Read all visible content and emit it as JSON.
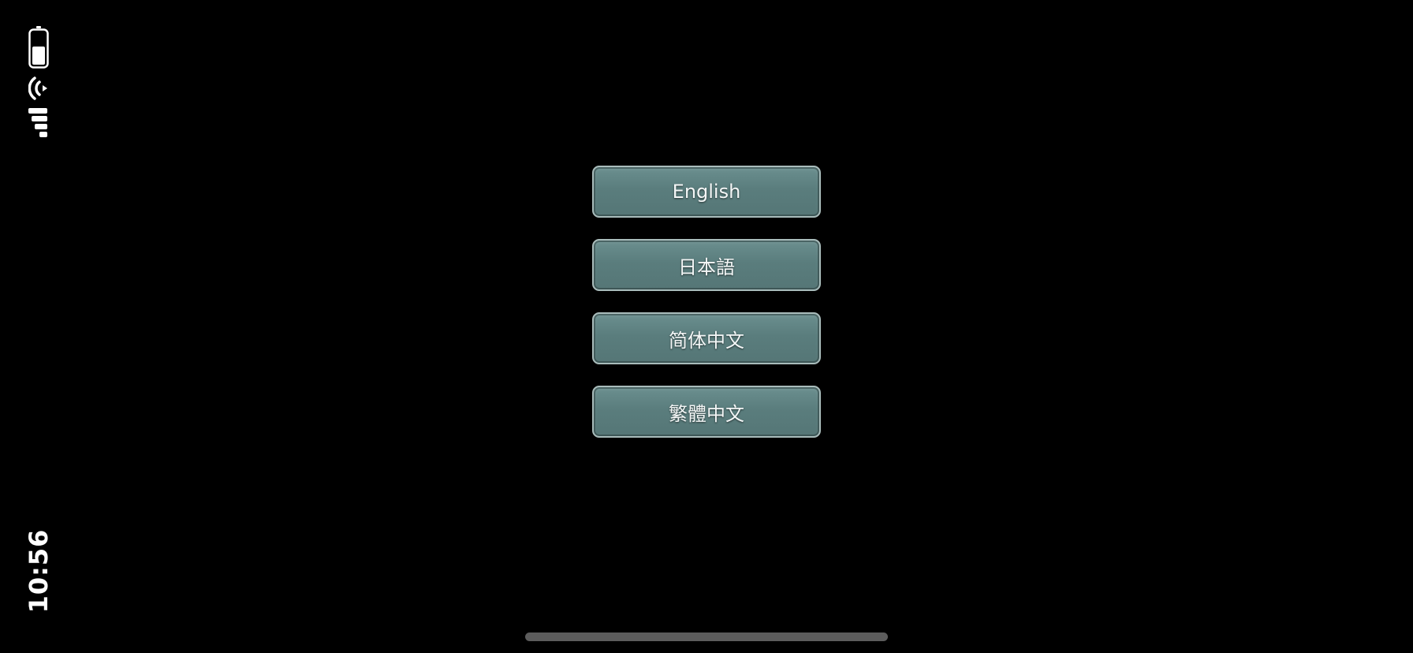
{
  "status_bar": {
    "time": "10:56",
    "battery_icon": "battery-icon",
    "wifi_icon": "wifi-icon",
    "signal_icon": "cellular-signal-icon"
  },
  "language_menu": {
    "options": [
      {
        "label": "English"
      },
      {
        "label": "日本語"
      },
      {
        "label": "简体中文"
      },
      {
        "label": "繁體中文"
      }
    ]
  },
  "colors": {
    "background": "#000000",
    "button_fill": "#5f8383",
    "button_border": "#a9bcbb",
    "button_text": "#f4f7f7"
  }
}
